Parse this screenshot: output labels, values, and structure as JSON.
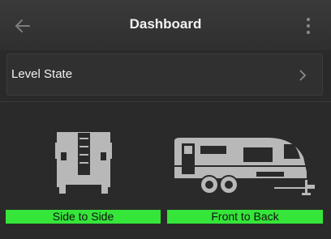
{
  "header": {
    "title": "Dashboard",
    "back_icon": "arrow-left-icon",
    "menu_icon": "more-vertical-icon"
  },
  "level_card": {
    "label": "Level State",
    "icon": "chevron-right-icon"
  },
  "buttons": {
    "side_to_side": "Side to Side",
    "front_to_back": "Front to Back"
  },
  "colors": {
    "background": "#2a2a2a",
    "appbar": "#333333",
    "button_green": "#35e53a",
    "illustration": "#b8b8b8"
  }
}
